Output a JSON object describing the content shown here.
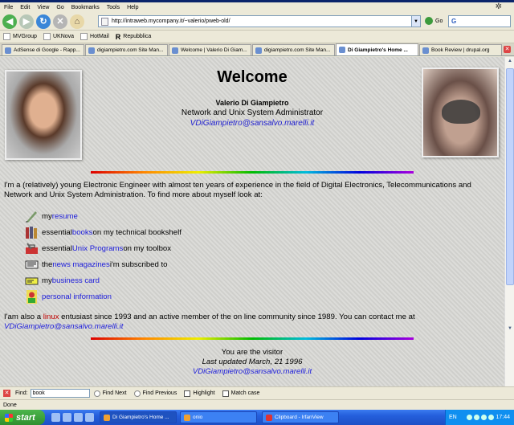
{
  "menu": [
    "File",
    "Edit",
    "View",
    "Go",
    "Bookmarks",
    "Tools",
    "Help"
  ],
  "nav": {
    "url": "http://intraweb.mycompany.it/~valerio/pweb-old/",
    "go_label": "Go",
    "search_engine": "G"
  },
  "bookmarks": [
    {
      "label": "MVGroup"
    },
    {
      "label": "UKNova"
    },
    {
      "label": "HotMail"
    },
    {
      "label": "Repubblica",
      "icon": "R"
    }
  ],
  "tabs": [
    {
      "label": "AdSense di Google - Rapp..."
    },
    {
      "label": "digiampietro.com Site Man..."
    },
    {
      "label": "Welcome | Valerio Di Giam..."
    },
    {
      "label": "digiampietro.com Site Man..."
    },
    {
      "label": "Di Giampietro's Home ...",
      "active": true
    },
    {
      "label": "Book Review | drupal.org"
    }
  ],
  "page": {
    "title": "Welcome",
    "name": "Valerio Di Giampietro",
    "role": "Network and Unix System Administrator",
    "email": "VDiGiampietro@sansalvo.marelli.it",
    "intro": "I'm a (relatively) young Electronic Engineer with almost ten years of experience in the field of Digital Electronics, Telecommunications and Network and Unix System Administration. To find more about myself look at:",
    "links": [
      {
        "pre": "my ",
        "link": "resume",
        "post": "",
        "icon": "pen-icon"
      },
      {
        "pre": "essential ",
        "link": "books",
        "post": " on my technical bookshelf",
        "icon": "books-icon"
      },
      {
        "pre": "essential ",
        "link": "Unix Programs",
        "post": " on my toolbox",
        "icon": "toolbox-icon"
      },
      {
        "pre": "the ",
        "link": "news magazines",
        "post": " i'm subscribed to",
        "icon": "newspaper-icon"
      },
      {
        "pre": "my ",
        "link": "business card",
        "post": "",
        "icon": "card-icon"
      },
      {
        "pre": "",
        "link": "personal information",
        "post": "",
        "icon": "person-icon"
      }
    ],
    "also_pre": "I'am also a ",
    "also_link": "linux",
    "also_post": " entusiast since 1993 and an active member of the on line community since 1989. You can contact me at",
    "also_email": "VDiGiampietro@sansalvo.marelli.it",
    "visitor": "You are the visitor",
    "updated": "Last updated March, 21 1996",
    "footer_email": "VDiGiampietro@sansalvo.marelli.it"
  },
  "find": {
    "label": "Find:",
    "value": "book",
    "next": "Find Next",
    "previous": "Find Previous",
    "highlight": "Highlight",
    "match_case": "Match case"
  },
  "status": "Done",
  "taskbar": {
    "start": "start",
    "tasks": [
      {
        "label": "Di Giampietro's Home ...",
        "active": true
      },
      {
        "label": "onio"
      },
      {
        "label": "Clipboard - IrfanView"
      }
    ],
    "lang": "EN",
    "clock": "17:44"
  },
  "colors": {
    "link": "#1c1cdc",
    "linux": "#c00000",
    "accent": "#245edb"
  }
}
